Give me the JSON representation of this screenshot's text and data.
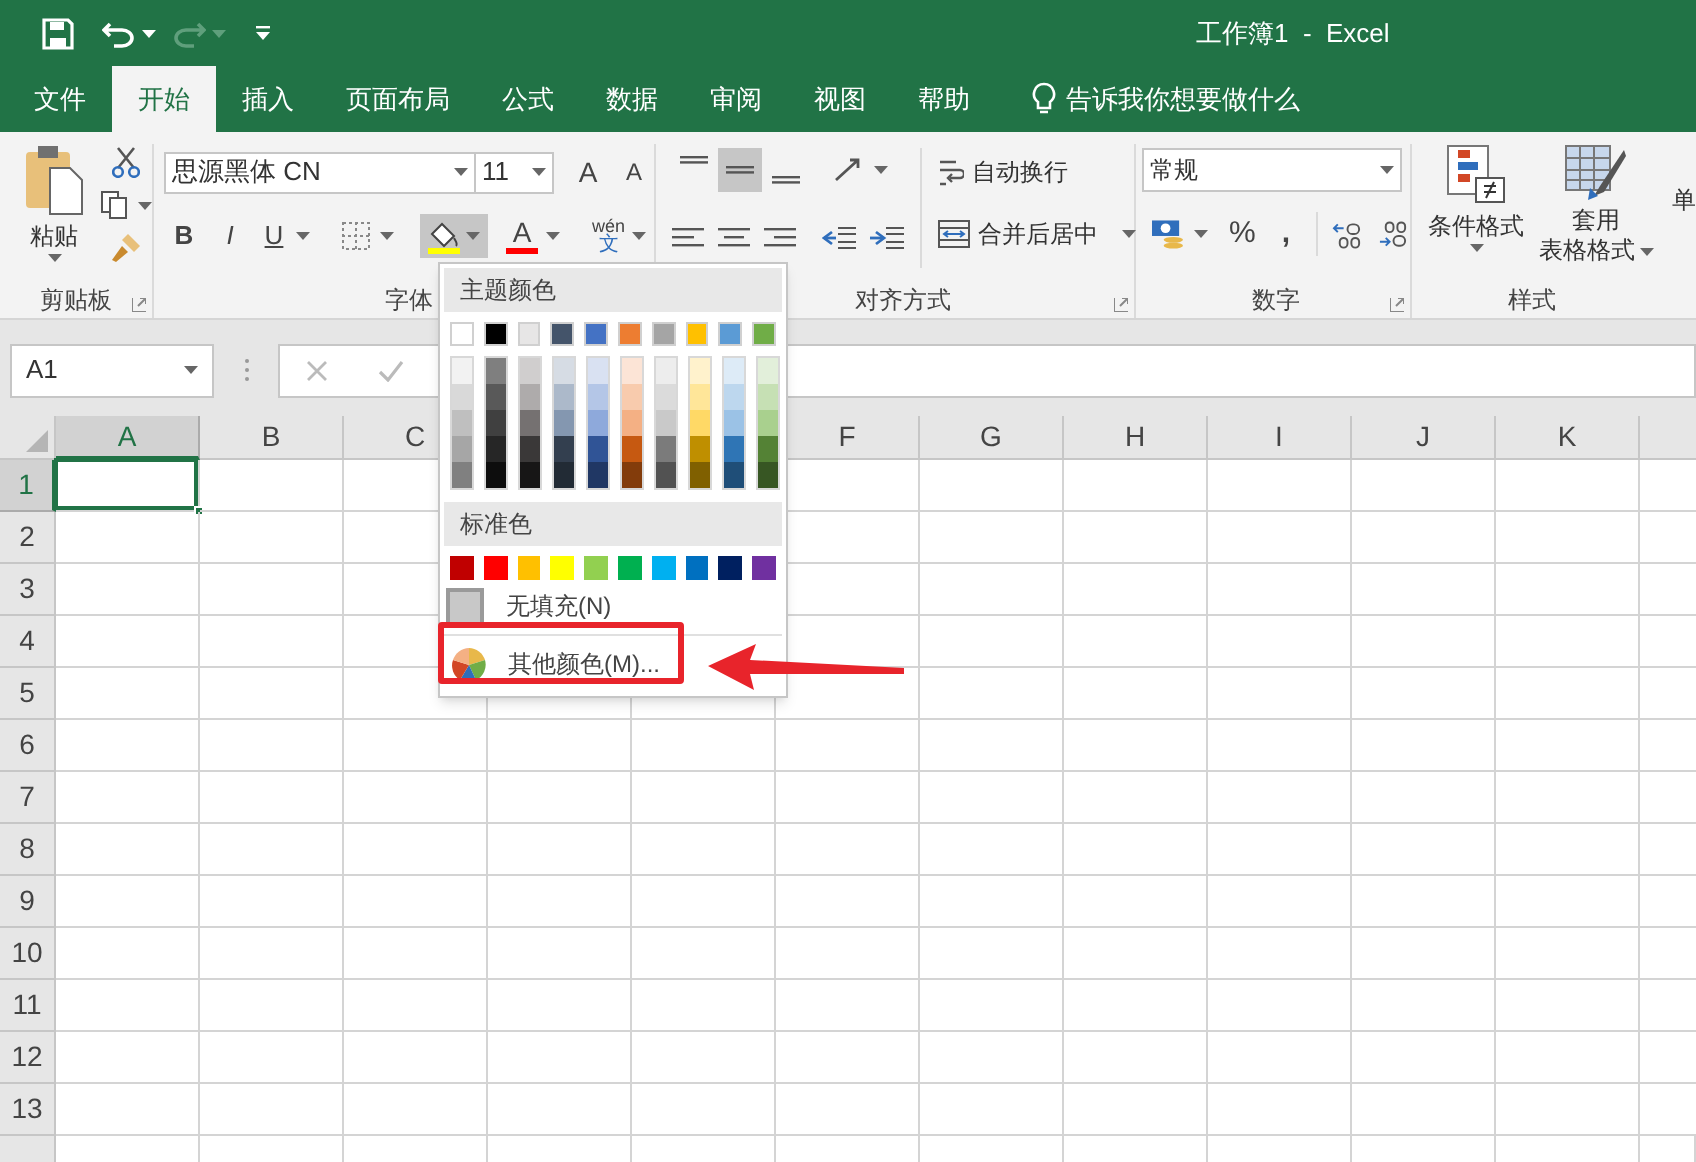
{
  "title_bar": {
    "title": "工作簿1  -  Excel"
  },
  "menu_tabs": [
    {
      "label": "文件",
      "selected": false
    },
    {
      "label": "开始",
      "selected": true
    },
    {
      "label": "插入",
      "selected": false
    },
    {
      "label": "页面布局",
      "selected": false
    },
    {
      "label": "公式",
      "selected": false
    },
    {
      "label": "数据",
      "selected": false
    },
    {
      "label": "审阅",
      "selected": false
    },
    {
      "label": "视图",
      "selected": false
    },
    {
      "label": "帮助",
      "selected": false
    }
  ],
  "tell_me": "告诉我你想要做什么",
  "ribbon": {
    "clipboard": {
      "paste": "粘贴",
      "label": "剪贴板"
    },
    "font": {
      "font_name": "思源黑体 CN",
      "font_size": "11",
      "grow": "A",
      "shrink": "A",
      "bold": "B",
      "italic": "I",
      "underline": "U",
      "font_color": "A",
      "phonetic_top": "wén",
      "phonetic_bottom": "文",
      "fill_open": true,
      "label": "字体"
    },
    "alignment": {
      "vertical": [
        {
          "kind": "top",
          "selected": false
        },
        {
          "kind": "middle",
          "selected": true
        },
        {
          "kind": "bottom",
          "selected": false
        }
      ],
      "wrap": "自动换行",
      "merge": "合并后居中",
      "label": "对齐方式"
    },
    "number": {
      "format": "常规",
      "percent": "%",
      "comma": ",",
      "label": "数字"
    },
    "styles": {
      "conditional": "条件格式",
      "table_top": "套用",
      "table_bottom": "表格格式",
      "cell_styles": "单",
      "label": "样式"
    }
  },
  "name_box": "A1",
  "columns": [
    {
      "label": "A",
      "selected": true
    },
    {
      "label": "B",
      "selected": false
    },
    {
      "label": "C",
      "selected": false
    },
    {
      "label": "F",
      "selected": false
    },
    {
      "label": "G",
      "selected": false
    },
    {
      "label": "H",
      "selected": false
    },
    {
      "label": "I",
      "selected": false
    },
    {
      "label": "J",
      "selected": false
    },
    {
      "label": "K",
      "selected": false
    }
  ],
  "rows": [
    {
      "label": "1",
      "selected": true
    },
    {
      "label": "2",
      "selected": false
    },
    {
      "label": "3",
      "selected": false
    },
    {
      "label": "4",
      "selected": false
    },
    {
      "label": "5",
      "selected": false
    },
    {
      "label": "6",
      "selected": false
    },
    {
      "label": "7",
      "selected": false
    },
    {
      "label": "8",
      "selected": false
    },
    {
      "label": "9",
      "selected": false
    },
    {
      "label": "10",
      "selected": false
    },
    {
      "label": "11",
      "selected": false
    },
    {
      "label": "12",
      "selected": false
    },
    {
      "label": "13",
      "selected": false
    }
  ],
  "fill_menu": {
    "theme_header": "主题颜色",
    "theme_colors": [
      {
        "color": "#ffffff"
      },
      {
        "color": "#000000"
      },
      {
        "color": "#e7e6e6"
      },
      {
        "color": "#44546a"
      },
      {
        "color": "#4472c4"
      },
      {
        "color": "#ed7d31"
      },
      {
        "color": "#a5a5a5"
      },
      {
        "color": "#ffc000"
      },
      {
        "color": "#5b9bd5"
      },
      {
        "color": "#70ad47"
      }
    ],
    "theme_shades": [
      [
        {
          "color": "#f2f2f2"
        },
        {
          "color": "#d9d9d9"
        },
        {
          "color": "#bfbfbf"
        },
        {
          "color": "#a6a6a6"
        },
        {
          "color": "#808080"
        }
      ],
      [
        {
          "color": "#7f7f7f"
        },
        {
          "color": "#595959"
        },
        {
          "color": "#404040"
        },
        {
          "color": "#262626"
        },
        {
          "color": "#0d0d0d"
        }
      ],
      [
        {
          "color": "#d0cece"
        },
        {
          "color": "#aeabab"
        },
        {
          "color": "#757171"
        },
        {
          "color": "#3a3838"
        },
        {
          "color": "#171616"
        }
      ],
      [
        {
          "color": "#d6dce4"
        },
        {
          "color": "#acb9ca"
        },
        {
          "color": "#8497b0"
        },
        {
          "color": "#333f4f"
        },
        {
          "color": "#222b35"
        }
      ],
      [
        {
          "color": "#d9e1f2"
        },
        {
          "color": "#b4c6e7"
        },
        {
          "color": "#8ea9db"
        },
        {
          "color": "#305496"
        },
        {
          "color": "#203764"
        }
      ],
      [
        {
          "color": "#fce4d6"
        },
        {
          "color": "#f8cbad"
        },
        {
          "color": "#f4b084"
        },
        {
          "color": "#c65911"
        },
        {
          "color": "#833c0b"
        }
      ],
      [
        {
          "color": "#ededed"
        },
        {
          "color": "#dbdbdb"
        },
        {
          "color": "#c9c9c9"
        },
        {
          "color": "#7b7b7b"
        },
        {
          "color": "#525252"
        }
      ],
      [
        {
          "color": "#fff2cc"
        },
        {
          "color": "#ffe699"
        },
        {
          "color": "#ffd966"
        },
        {
          "color": "#bf8f00"
        },
        {
          "color": "#806000"
        }
      ],
      [
        {
          "color": "#ddebf7"
        },
        {
          "color": "#bdd7ee"
        },
        {
          "color": "#9bc2e6"
        },
        {
          "color": "#2f75b5"
        },
        {
          "color": "#1f4e78"
        }
      ],
      [
        {
          "color": "#e2efda"
        },
        {
          "color": "#c6e0b4"
        },
        {
          "color": "#a9d08e"
        },
        {
          "color": "#548235"
        },
        {
          "color": "#375623"
        }
      ]
    ],
    "standard_header": "标准色",
    "standard_colors": [
      {
        "color": "#c00000"
      },
      {
        "color": "#ff0000"
      },
      {
        "color": "#ffc000"
      },
      {
        "color": "#ffff00"
      },
      {
        "color": "#92d050"
      },
      {
        "color": "#00b050"
      },
      {
        "color": "#00b0f0"
      },
      {
        "color": "#0070c0"
      },
      {
        "color": "#002060"
      },
      {
        "color": "#7030a0"
      }
    ],
    "no_fill": "无填充(N)",
    "more_colors": "其他颜色(M)...",
    "more_colors_highlighted": true
  }
}
